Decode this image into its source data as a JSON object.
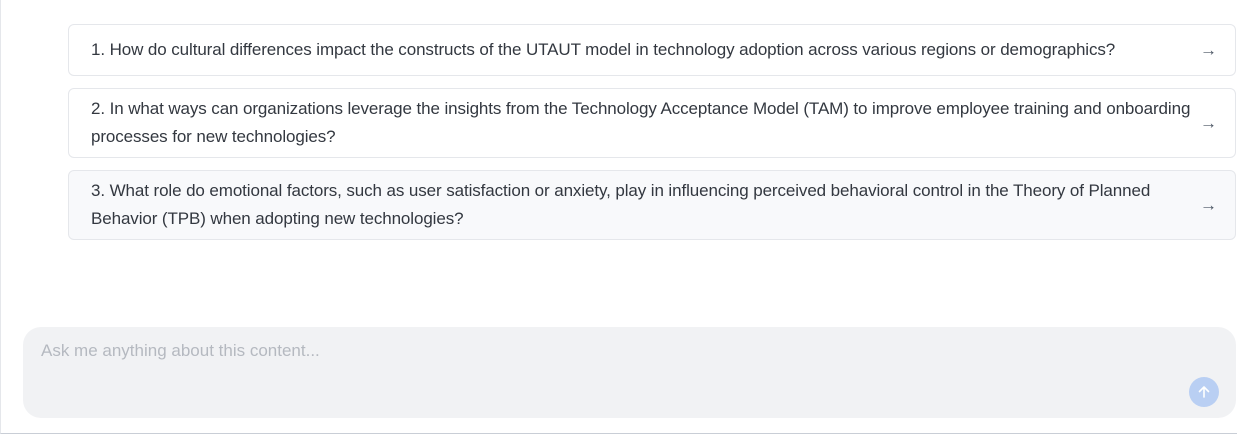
{
  "suggestions": [
    {
      "text": "1. How do cultural differences impact the constructs of the UTAUT model in technology adoption across various regions or demographics?",
      "arrow": "→"
    },
    {
      "text": "2. In what ways can organizations leverage the insights from the Technology Acceptance Model (TAM) to improve employee training and onboarding processes for new technologies?",
      "arrow": "→"
    },
    {
      "text": "3. What role do emotional factors, such as user satisfaction or anxiety, play in influencing perceived behavioral control in the Theory of Planned Behavior (TPB) when adopting new technologies?",
      "arrow": "→"
    }
  ],
  "chat": {
    "placeholder": "Ask me anything about this content...",
    "value": "",
    "send_icon": "arrow-up-icon"
  },
  "colors": {
    "send_button": "#b9cff3",
    "chat_background": "#f1f2f4",
    "card_border": "#e5e7eb"
  }
}
